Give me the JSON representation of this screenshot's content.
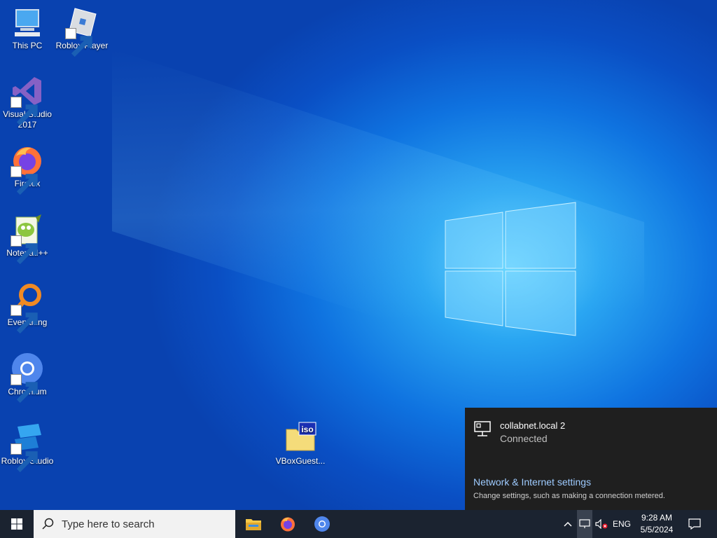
{
  "desktop": {
    "icons": [
      {
        "label": "This PC",
        "icon": "this-pc-icon"
      },
      {
        "label": "Roblox Player",
        "icon": "roblox-player-icon"
      },
      {
        "label": "Visual Studio 2017",
        "icon": "visual-studio-icon"
      },
      {
        "label": "Firefox",
        "icon": "firefox-icon"
      },
      {
        "label": "Notepad++",
        "icon": "notepad-plus-plus-icon"
      },
      {
        "label": "Everything",
        "icon": "everything-search-icon"
      },
      {
        "label": "Chromium",
        "icon": "chromium-icon"
      },
      {
        "label": "Roblox Studio",
        "icon": "roblox-studio-icon"
      },
      {
        "label": "VBoxGuest...",
        "icon": "iso-file-icon"
      }
    ]
  },
  "network_flyout": {
    "network_name": "collabnet.local 2",
    "status": "Connected",
    "settings_link": "Network & Internet settings",
    "settings_description": "Change settings, such as making a connection metered."
  },
  "taskbar": {
    "search_placeholder": "Type here to search",
    "pinned": [
      "file-explorer-icon",
      "firefox-icon",
      "chromium-icon"
    ],
    "tray": {
      "language": "ENG",
      "time": "9:28 AM",
      "date": "5/5/2024"
    }
  },
  "colors": {
    "flyout_bg": "#1f1f1f",
    "link": "#9ecbff",
    "taskbar_bg": "#1b2330"
  }
}
